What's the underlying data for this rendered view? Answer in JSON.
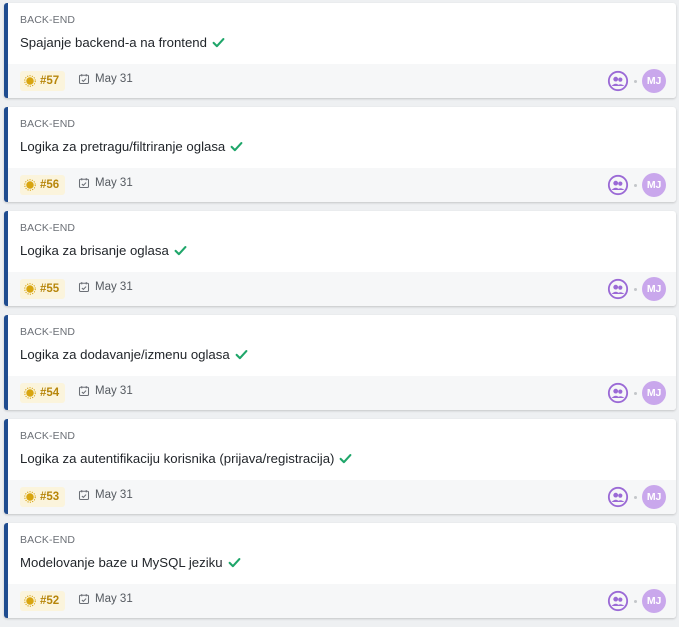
{
  "colors": {
    "card_accent": "#1f4c8f",
    "done_check": "#1fa66a",
    "issue_badge_text": "#b7860b",
    "avatar_bg": "#c9a7ec",
    "group_icon": "#9b6ad6"
  },
  "icons": {
    "done": "check-icon",
    "issue": "sun-icon",
    "due": "calendar-check-icon",
    "team": "group-icon"
  },
  "cards": [
    {
      "category": "BACK-END",
      "title": "Spajanje backend-a na frontend",
      "issue": "#57",
      "due": "May 31",
      "assignee_initials": "MJ"
    },
    {
      "category": "BACK-END",
      "title": "Logika za pretragu/filtriranje oglasa",
      "issue": "#56",
      "due": "May 31",
      "assignee_initials": "MJ"
    },
    {
      "category": "BACK-END",
      "title": "Logika za brisanje oglasa",
      "issue": "#55",
      "due": "May 31",
      "assignee_initials": "MJ"
    },
    {
      "category": "BACK-END",
      "title": "Logika za dodavanje/izmenu oglasa",
      "issue": "#54",
      "due": "May 31",
      "assignee_initials": "MJ"
    },
    {
      "category": "BACK-END",
      "title": "Logika za autentifikaciju korisnika (prijava/registracija)",
      "issue": "#53",
      "due": "May 31",
      "assignee_initials": "MJ"
    },
    {
      "category": "BACK-END",
      "title": "Modelovanje baze u MySQL jeziku",
      "issue": "#52",
      "due": "May 31",
      "assignee_initials": "MJ"
    }
  ]
}
